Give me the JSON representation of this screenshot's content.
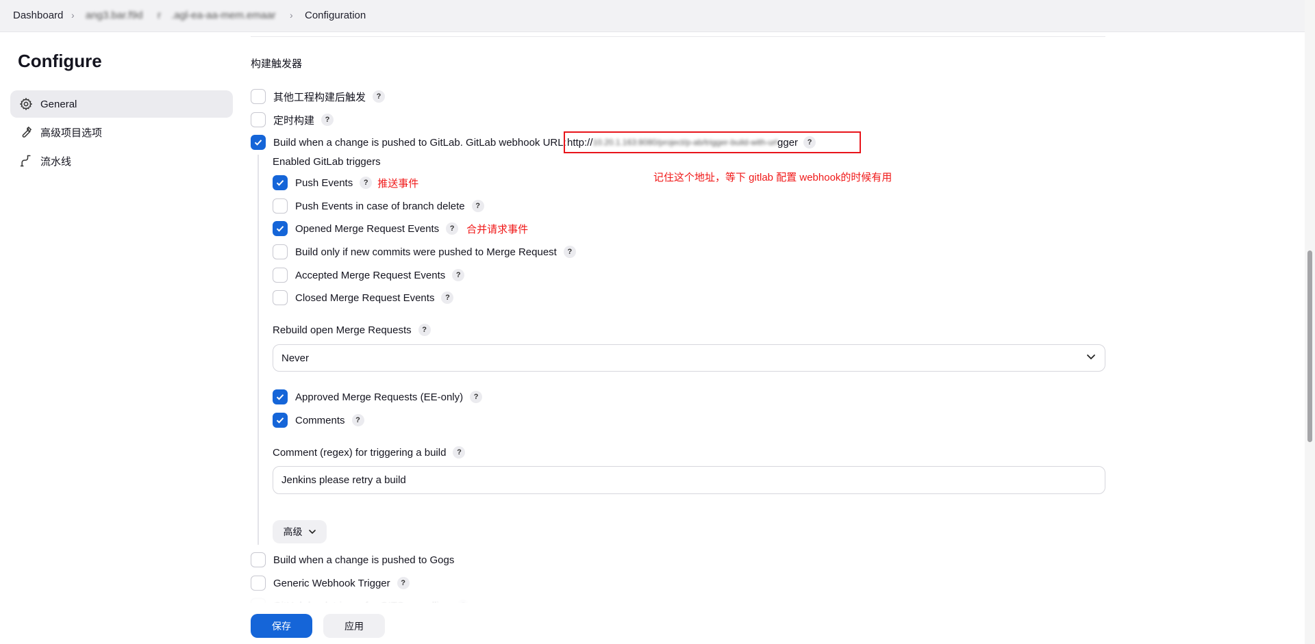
{
  "breadcrumb": {
    "items": [
      "Dashboard",
      "ang3.bar.f9d",
      "r",
      ".agl-ea-aa-mem.emaar",
      "Configuration"
    ]
  },
  "sidebar": {
    "title": "Configure",
    "items": [
      {
        "label": "General",
        "icon": "gear-icon",
        "active": true
      },
      {
        "label": "高级项目选项",
        "icon": "wrench-icon",
        "active": false
      },
      {
        "label": "流水线",
        "icon": "pipeline-icon",
        "active": false
      }
    ]
  },
  "main": {
    "section_title": "构建触发器",
    "triggers": [
      {
        "label": "其他工程构建后触发",
        "checked": false
      },
      {
        "label": "定时构建",
        "checked": false
      },
      {
        "label": "Build when a change is pushed to GitLab. GitLab webhook URL:",
        "checked": true
      }
    ],
    "webhook_url": {
      "prefix": "http://",
      "masked": "10.20.1.163:8080/project/p-ab/trigger-build-with-url",
      "suffix": "gger"
    },
    "webhook_annotation": "记住这个地址，等下 gitlab 配置 webhook的时候有用",
    "gitlab": {
      "enabled_triggers_label": "Enabled GitLab triggers",
      "events": [
        {
          "label": "Push Events",
          "checked": true,
          "annotation": "推送事件"
        },
        {
          "label": "Push Events in case of branch delete",
          "checked": false,
          "annotation": ""
        },
        {
          "label": "Opened Merge Request Events",
          "checked": true,
          "annotation": "合并请求事件"
        },
        {
          "label": "Build only if new commits were pushed to Merge Request",
          "checked": false,
          "annotation": ""
        },
        {
          "label": "Accepted Merge Request Events",
          "checked": false,
          "annotation": ""
        },
        {
          "label": "Closed Merge Request Events",
          "checked": false,
          "annotation": ""
        }
      ],
      "rebuild_label": "Rebuild open Merge Requests",
      "rebuild_value": "Never",
      "extra": [
        {
          "label": "Approved Merge Requests (EE-only)",
          "checked": true
        },
        {
          "label": "Comments",
          "checked": true
        }
      ],
      "comment_regex_label": "Comment (regex) for triggering a build",
      "comment_regex_value": "Jenkins please retry a build",
      "advanced_label": "高级"
    },
    "more_triggers": [
      {
        "label": "Build when a change is pushed to Gogs",
        "checked": false
      },
      {
        "label": "Generic Webhook Trigger",
        "checked": false
      },
      {
        "label": "GitHub hook trigger for GITScm polling",
        "checked": false
      }
    ]
  },
  "footer": {
    "save_label": "保存",
    "apply_label": "应用"
  },
  "colors": {
    "accent": "#1565d8",
    "annotation": "#f01818"
  }
}
